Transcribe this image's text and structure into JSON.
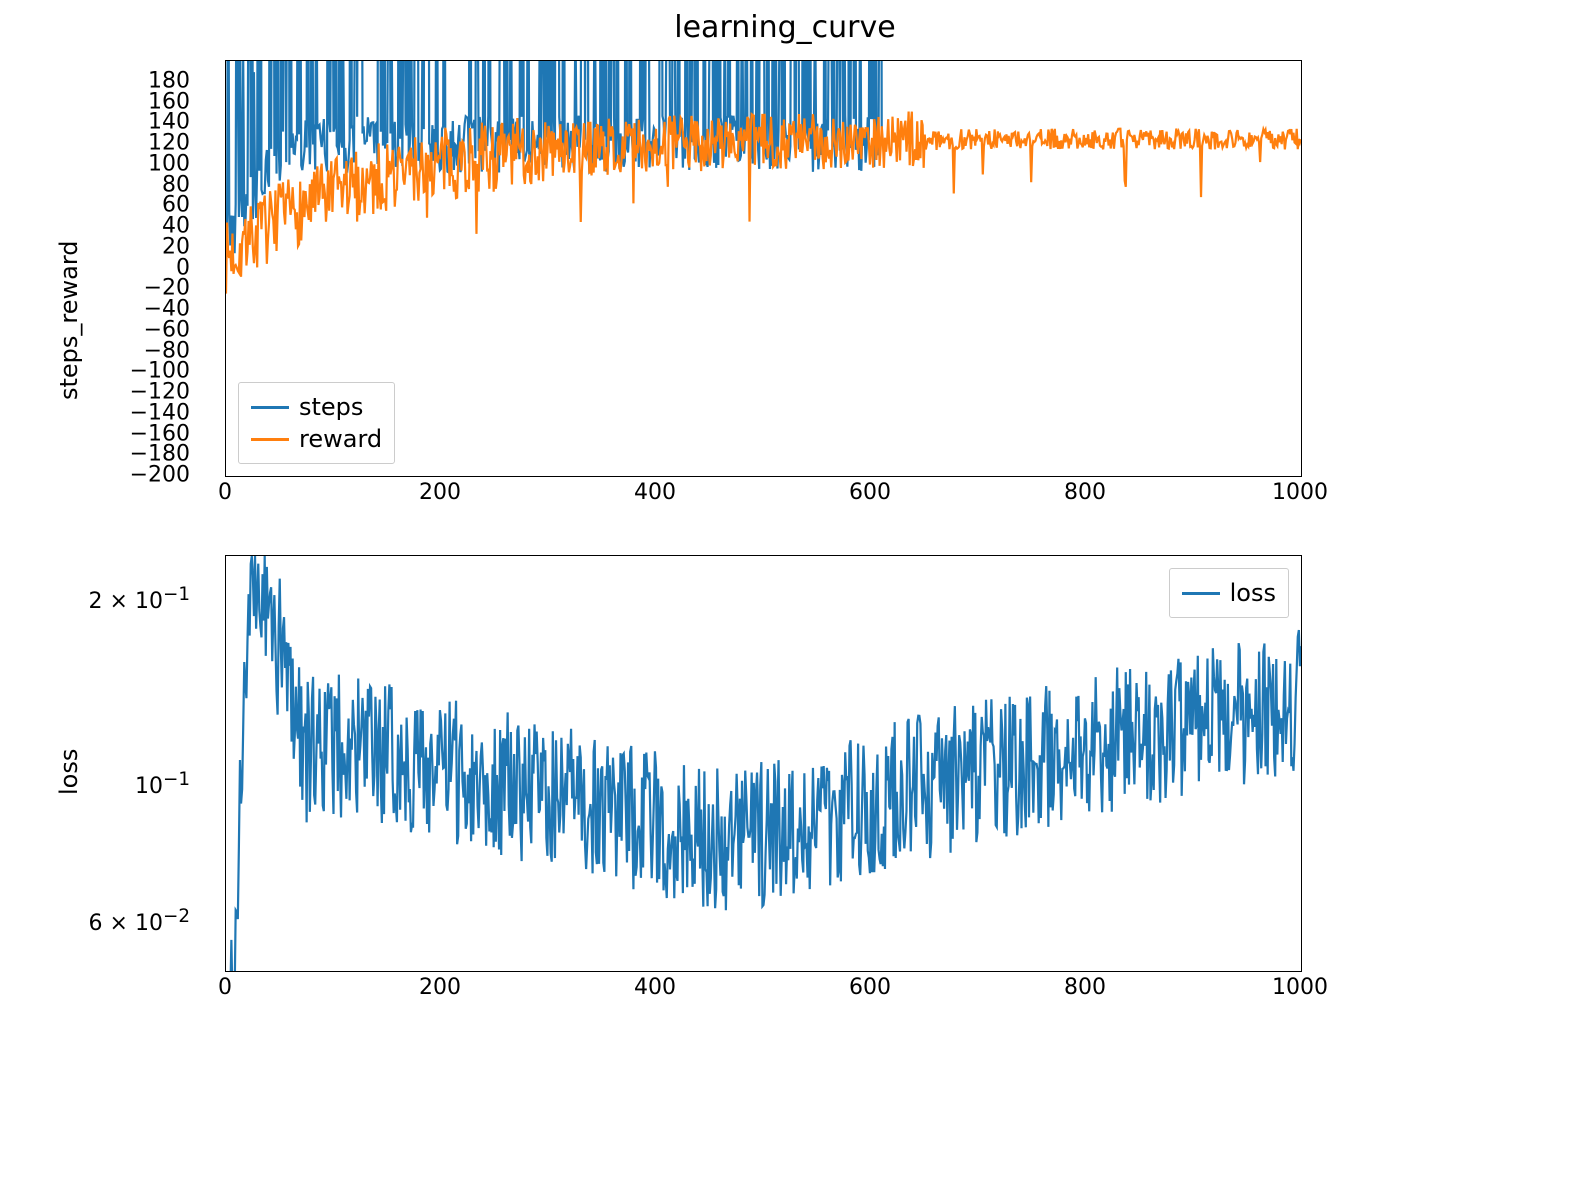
{
  "chart_data": [
    {
      "type": "line",
      "title": "learning_curve",
      "xlabel": "",
      "ylabel": "steps_reward",
      "xlim": [
        0,
        1000
      ],
      "ylim": [
        -200,
        200
      ],
      "xticks": [
        0,
        200,
        400,
        600,
        800,
        1000
      ],
      "yticks": [
        -200,
        -180,
        -160,
        -140,
        -120,
        -100,
        -80,
        -60,
        -40,
        -20,
        0,
        20,
        40,
        60,
        80,
        100,
        120,
        140,
        160,
        180
      ],
      "yticklabels": [
        "−200",
        "−180",
        "−160",
        "−140",
        "−120",
        "−100",
        "−80",
        "−60",
        "−40",
        "−20",
        "0",
        "20",
        "40",
        "60",
        "80",
        "100",
        "120",
        "140",
        "160",
        "180"
      ],
      "legend_position": "lower-left",
      "series": [
        {
          "name": "steps",
          "color": "#1f77b4",
          "description": "Highly noisy signal. Starts near 20–30, spikes repeatedly above 200 until roughly x≈610, then drops out (values clip/exceed ylim)."
        },
        {
          "name": "reward",
          "color": "#ff7f0e",
          "description": "Noisy upward trend from ~10 at x=0 to a plateau around 120–130 by x≈300, occasional downward spikes, stabilizing ~125 after x≈650."
        }
      ]
    },
    {
      "type": "line",
      "title": "",
      "xlabel": "",
      "ylabel": "loss",
      "xlim": [
        0,
        1000
      ],
      "ylim_log": [
        0.053,
        0.25
      ],
      "yscale": "log",
      "xticks": [
        0,
        200,
        400,
        600,
        800,
        1000
      ],
      "ytick_values": [
        0.06,
        0.1,
        0.2
      ],
      "yticklabels": [
        "6 × 10⁻²",
        "10⁻¹",
        "2 × 10⁻¹"
      ],
      "legend_position": "upper-right",
      "series": [
        {
          "name": "loss",
          "color": "#1f77b4",
          "description": "Starts below 0.05, spikes to ~0.23 near x≈15, noisy decline to ~0.085 around x≈450–500, then noisy rise to ~0.14–0.15 by x=1000."
        }
      ]
    }
  ],
  "title": "learning_curve",
  "ax1": {
    "ylabel": "steps_reward",
    "legend": {
      "items": [
        "steps",
        "reward"
      ]
    }
  },
  "ax2": {
    "ylabel": "loss",
    "legend": {
      "items": [
        "loss"
      ]
    },
    "ytick_labels": {
      "a": "2 × 10",
      "b": "10",
      "c": "6 × 10",
      "exp_neg1": "−1",
      "exp_neg2": "−2"
    }
  },
  "xticks": {
    "t0": "0",
    "t200": "200",
    "t400": "400",
    "t600": "600",
    "t800": "800",
    "t1000": "1000"
  },
  "colors": {
    "steps": "#1f77b4",
    "reward": "#ff7f0e",
    "loss": "#1f77b4"
  }
}
